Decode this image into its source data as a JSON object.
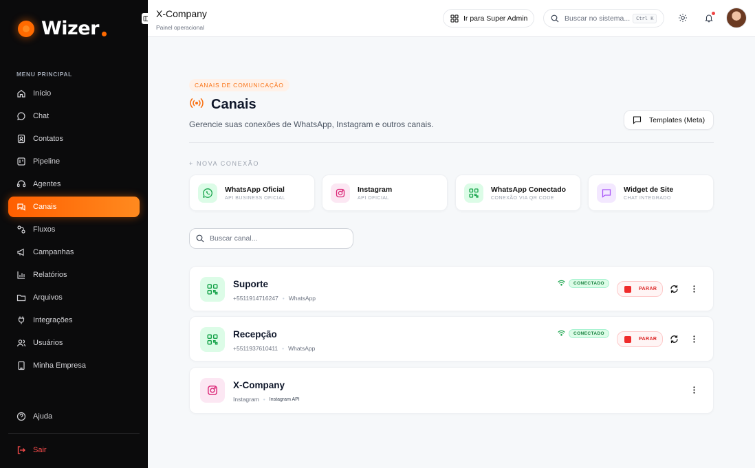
{
  "sidebar": {
    "logo": "Wizer",
    "menu_label": "MENU PRINCIPAL",
    "items": [
      {
        "label": "Início",
        "icon": "home-icon"
      },
      {
        "label": "Chat",
        "icon": "chat-icon"
      },
      {
        "label": "Contatos",
        "icon": "contacts-icon"
      },
      {
        "label": "Pipeline",
        "icon": "kanban-icon"
      },
      {
        "label": "Agentes",
        "icon": "bot-icon"
      },
      {
        "label": "Canais",
        "icon": "channels-icon",
        "active": true
      },
      {
        "label": "Fluxos",
        "icon": "flows-icon"
      },
      {
        "label": "Campanhas",
        "icon": "megaphone-icon"
      },
      {
        "label": "Relatórios",
        "icon": "chart-icon"
      },
      {
        "label": "Arquivos",
        "icon": "folder-icon"
      },
      {
        "label": "Integrações",
        "icon": "plug-icon"
      },
      {
        "label": "Usuários",
        "icon": "users-icon"
      },
      {
        "label": "Minha Empresa",
        "icon": "building-icon"
      }
    ],
    "help": "Ajuda",
    "logout": "Sair"
  },
  "header": {
    "company": "X-Company",
    "subtitle": "Painel operacional",
    "admin_button": "Ir para Super Admin",
    "search_placeholder": "Buscar no sistema...",
    "shortcut": "Ctrl K"
  },
  "main": {
    "section_badge": "CANAIS DE COMUNICAÇÃO",
    "title": "Canais",
    "description": "Gerencie suas conexões de WhatsApp, Instagram e outros canais.",
    "templates_button": "Templates (Meta)",
    "new_connection_label": "+ NOVA CONEXÃO",
    "connection_types": [
      {
        "title": "WhatsApp Oficial",
        "subtitle": "API BUSINESS OFICIAL",
        "icon": "whatsapp-icon",
        "color": "#16a34a",
        "bg": "#dcfce7"
      },
      {
        "title": "Instagram",
        "subtitle": "API OFICIAL",
        "icon": "instagram-icon",
        "color": "#db2777",
        "bg": "#fce7f3"
      },
      {
        "title": "WhatsApp Conectado",
        "subtitle": "CONEXÃO VIA QR CODE",
        "icon": "qrcode-icon",
        "color": "#16a34a",
        "bg": "#dcfce7"
      },
      {
        "title": "Widget de Site",
        "subtitle": "CHAT INTEGRADO",
        "icon": "message-square-icon",
        "color": "#a855f7",
        "bg": "#f3e8ff"
      }
    ],
    "search_channel_placeholder": "Buscar canal...",
    "channels": [
      {
        "name": "Suporte",
        "phone": "+5511914716247",
        "type": "WhatsApp",
        "status": "CONECTADO",
        "stop_label": "PARAR"
      },
      {
        "name": "Recepção",
        "phone": "+5511937610411",
        "type": "WhatsApp",
        "status": "CONECTADO",
        "stop_label": "PARAR"
      },
      {
        "name": "X-Company",
        "phone": "Instagram",
        "type": "Instagram API"
      }
    ]
  },
  "colors": {
    "accent": "#ff6a00",
    "connected": "#16a34a",
    "danger": "#dc2626"
  }
}
